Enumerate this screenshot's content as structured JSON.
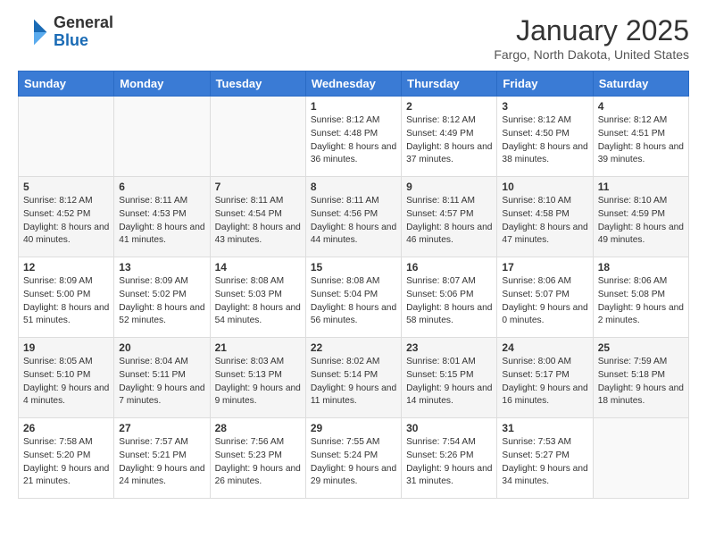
{
  "logo": {
    "general": "General",
    "blue": "Blue"
  },
  "title": "January 2025",
  "location": "Fargo, North Dakota, United States",
  "weekdays": [
    "Sunday",
    "Monday",
    "Tuesday",
    "Wednesday",
    "Thursday",
    "Friday",
    "Saturday"
  ],
  "weeks": [
    [
      {
        "day": "",
        "info": ""
      },
      {
        "day": "",
        "info": ""
      },
      {
        "day": "",
        "info": ""
      },
      {
        "day": "1",
        "info": "Sunrise: 8:12 AM\nSunset: 4:48 PM\nDaylight: 8 hours and 36 minutes."
      },
      {
        "day": "2",
        "info": "Sunrise: 8:12 AM\nSunset: 4:49 PM\nDaylight: 8 hours and 37 minutes."
      },
      {
        "day": "3",
        "info": "Sunrise: 8:12 AM\nSunset: 4:50 PM\nDaylight: 8 hours and 38 minutes."
      },
      {
        "day": "4",
        "info": "Sunrise: 8:12 AM\nSunset: 4:51 PM\nDaylight: 8 hours and 39 minutes."
      }
    ],
    [
      {
        "day": "5",
        "info": "Sunrise: 8:12 AM\nSunset: 4:52 PM\nDaylight: 8 hours and 40 minutes."
      },
      {
        "day": "6",
        "info": "Sunrise: 8:11 AM\nSunset: 4:53 PM\nDaylight: 8 hours and 41 minutes."
      },
      {
        "day": "7",
        "info": "Sunrise: 8:11 AM\nSunset: 4:54 PM\nDaylight: 8 hours and 43 minutes."
      },
      {
        "day": "8",
        "info": "Sunrise: 8:11 AM\nSunset: 4:56 PM\nDaylight: 8 hours and 44 minutes."
      },
      {
        "day": "9",
        "info": "Sunrise: 8:11 AM\nSunset: 4:57 PM\nDaylight: 8 hours and 46 minutes."
      },
      {
        "day": "10",
        "info": "Sunrise: 8:10 AM\nSunset: 4:58 PM\nDaylight: 8 hours and 47 minutes."
      },
      {
        "day": "11",
        "info": "Sunrise: 8:10 AM\nSunset: 4:59 PM\nDaylight: 8 hours and 49 minutes."
      }
    ],
    [
      {
        "day": "12",
        "info": "Sunrise: 8:09 AM\nSunset: 5:00 PM\nDaylight: 8 hours and 51 minutes."
      },
      {
        "day": "13",
        "info": "Sunrise: 8:09 AM\nSunset: 5:02 PM\nDaylight: 8 hours and 52 minutes."
      },
      {
        "day": "14",
        "info": "Sunrise: 8:08 AM\nSunset: 5:03 PM\nDaylight: 8 hours and 54 minutes."
      },
      {
        "day": "15",
        "info": "Sunrise: 8:08 AM\nSunset: 5:04 PM\nDaylight: 8 hours and 56 minutes."
      },
      {
        "day": "16",
        "info": "Sunrise: 8:07 AM\nSunset: 5:06 PM\nDaylight: 8 hours and 58 minutes."
      },
      {
        "day": "17",
        "info": "Sunrise: 8:06 AM\nSunset: 5:07 PM\nDaylight: 9 hours and 0 minutes."
      },
      {
        "day": "18",
        "info": "Sunrise: 8:06 AM\nSunset: 5:08 PM\nDaylight: 9 hours and 2 minutes."
      }
    ],
    [
      {
        "day": "19",
        "info": "Sunrise: 8:05 AM\nSunset: 5:10 PM\nDaylight: 9 hours and 4 minutes."
      },
      {
        "day": "20",
        "info": "Sunrise: 8:04 AM\nSunset: 5:11 PM\nDaylight: 9 hours and 7 minutes."
      },
      {
        "day": "21",
        "info": "Sunrise: 8:03 AM\nSunset: 5:13 PM\nDaylight: 9 hours and 9 minutes."
      },
      {
        "day": "22",
        "info": "Sunrise: 8:02 AM\nSunset: 5:14 PM\nDaylight: 9 hours and 11 minutes."
      },
      {
        "day": "23",
        "info": "Sunrise: 8:01 AM\nSunset: 5:15 PM\nDaylight: 9 hours and 14 minutes."
      },
      {
        "day": "24",
        "info": "Sunrise: 8:00 AM\nSunset: 5:17 PM\nDaylight: 9 hours and 16 minutes."
      },
      {
        "day": "25",
        "info": "Sunrise: 7:59 AM\nSunset: 5:18 PM\nDaylight: 9 hours and 18 minutes."
      }
    ],
    [
      {
        "day": "26",
        "info": "Sunrise: 7:58 AM\nSunset: 5:20 PM\nDaylight: 9 hours and 21 minutes."
      },
      {
        "day": "27",
        "info": "Sunrise: 7:57 AM\nSunset: 5:21 PM\nDaylight: 9 hours and 24 minutes."
      },
      {
        "day": "28",
        "info": "Sunrise: 7:56 AM\nSunset: 5:23 PM\nDaylight: 9 hours and 26 minutes."
      },
      {
        "day": "29",
        "info": "Sunrise: 7:55 AM\nSunset: 5:24 PM\nDaylight: 9 hours and 29 minutes."
      },
      {
        "day": "30",
        "info": "Sunrise: 7:54 AM\nSunset: 5:26 PM\nDaylight: 9 hours and 31 minutes."
      },
      {
        "day": "31",
        "info": "Sunrise: 7:53 AM\nSunset: 5:27 PM\nDaylight: 9 hours and 34 minutes."
      },
      {
        "day": "",
        "info": ""
      }
    ]
  ]
}
